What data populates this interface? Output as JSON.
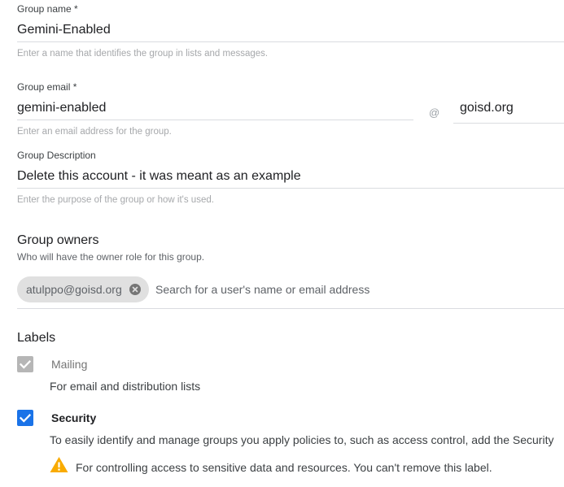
{
  "group_name": {
    "label": "Group name *",
    "value": "Gemini-Enabled",
    "hint": "Enter a name that identifies the group in lists and messages."
  },
  "group_email": {
    "label": "Group email *",
    "value": "gemini-enabled",
    "at": "@",
    "domain": "goisd.org",
    "hint": "Enter an email address for the group."
  },
  "group_description": {
    "label": "Group Description",
    "value": "Delete this account - it was meant as an example",
    "hint": "Enter the purpose of the group or how it's used."
  },
  "owners": {
    "title": "Group owners",
    "subtitle": "Who will have the owner role for this group.",
    "chip": "atulppo@goisd.org",
    "search_placeholder": "Search for a user's name or email address"
  },
  "labels": {
    "title": "Labels",
    "items": [
      {
        "name": "Mailing",
        "description": "For email and distribution lists",
        "checked": true,
        "disabled": true
      },
      {
        "name": "Security",
        "description": "To easily identify and manage groups you apply policies to, such as access control, add the Security",
        "checked": true,
        "disabled": false,
        "warning": "For controlling access to sensitive data and resources. You can't remove this label."
      }
    ]
  },
  "colors": {
    "accent": "#1a73e8",
    "warning": "#f9ab00",
    "disabled_checkbox": "#b6b6b6",
    "chip_bg": "#e0e0e0"
  }
}
